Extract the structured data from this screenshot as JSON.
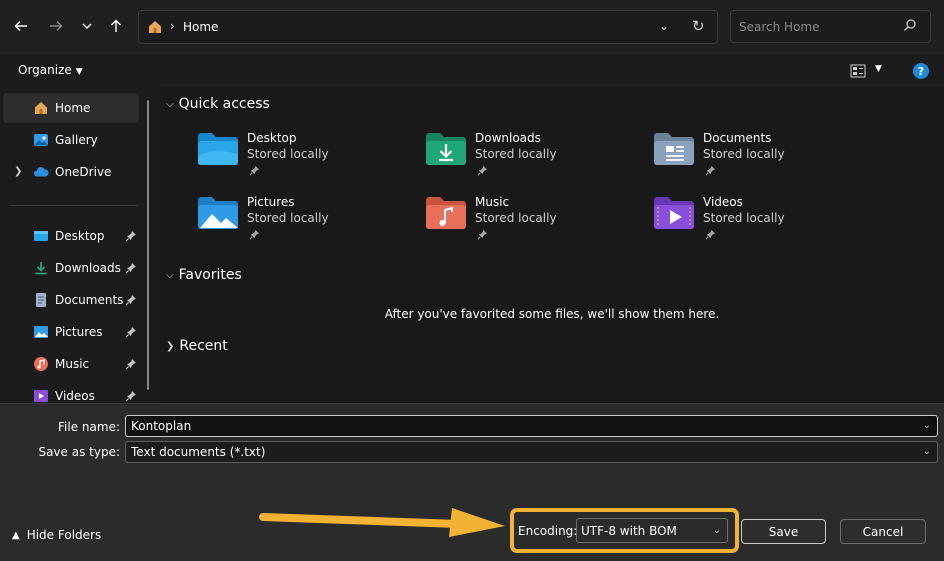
{
  "nav": {
    "back_icon": "arrow-left-icon",
    "forward_icon": "arrow-right-icon",
    "recent_icon": "chevron-down-icon",
    "up_icon": "arrow-up-icon"
  },
  "address": {
    "crumb": "Home"
  },
  "search": {
    "placeholder": "Search Home"
  },
  "commandbar": {
    "organize": "Organize",
    "help": "?"
  },
  "sidebar": {
    "items": [
      {
        "label": "Home",
        "icon": "home-icon",
        "selected": true
      },
      {
        "label": "Gallery",
        "icon": "gallery-icon"
      },
      {
        "label": "OneDrive",
        "icon": "onedrive-cloud-icon"
      },
      {
        "label": "Desktop",
        "icon": "desktop-folder-icon",
        "pinned": true
      },
      {
        "label": "Downloads",
        "icon": "download-icon",
        "pinned": true
      },
      {
        "label": "Documents",
        "icon": "document-icon",
        "pinned": true
      },
      {
        "label": "Pictures",
        "icon": "pictures-icon",
        "pinned": true
      },
      {
        "label": "Music",
        "icon": "music-icon",
        "pinned": true
      },
      {
        "label": "Videos",
        "icon": "videos-icon",
        "pinned": true
      }
    ]
  },
  "main": {
    "quick_access": "Quick access",
    "favorites": "Favorites",
    "recent": "Recent",
    "favorites_empty": "After you've favorited some files, we'll show them here.",
    "tiles": [
      {
        "name": "Desktop",
        "sub": "Stored locally",
        "icon": "desktop-folder-icon",
        "color": "#2aa6e8"
      },
      {
        "name": "Downloads",
        "sub": "Stored locally",
        "icon": "downloads-folder-icon",
        "color": "#21a67a"
      },
      {
        "name": "Documents",
        "sub": "Stored locally",
        "icon": "documents-folder-icon",
        "color": "#8aa2bd"
      },
      {
        "name": "Pictures",
        "sub": "Stored locally",
        "icon": "pictures-folder-icon",
        "color": "#2f9be6"
      },
      {
        "name": "Music",
        "sub": "Stored locally",
        "icon": "music-folder-icon",
        "color": "#e8705b"
      },
      {
        "name": "Videos",
        "sub": "Stored locally",
        "icon": "videos-folder-icon",
        "color": "#8a4fd8"
      }
    ]
  },
  "form": {
    "filename_label": "File name:",
    "filename_value": "Kontoplan",
    "type_label": "Save as type:",
    "type_value": "Text documents (*.txt)",
    "encoding_label": "Encoding:",
    "encoding_value": "UTF-8 with BOM",
    "save": "Save",
    "cancel": "Cancel",
    "hide_folders": "Hide Folders"
  },
  "colors": {
    "accent": "#1e8ad8",
    "highlight": "#f2b233"
  }
}
